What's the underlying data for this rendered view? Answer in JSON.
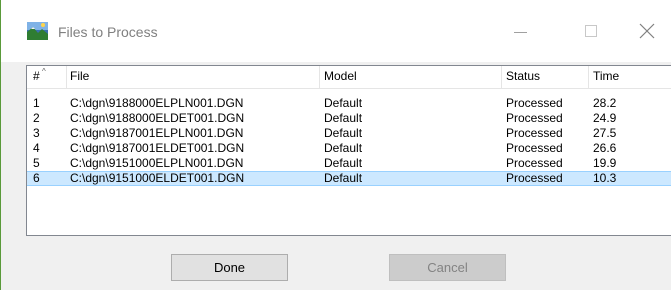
{
  "window": {
    "title": "Files to Process",
    "app_icon": "landscape-image-icon",
    "controls": [
      "minimize-icon",
      "maximize-icon",
      "close-icon"
    ]
  },
  "table": {
    "columns": [
      "#",
      "File",
      "Model",
      "Status",
      "Time"
    ],
    "sort_indicator": "^",
    "rows": [
      {
        "num": "1",
        "file": "C:\\dgn\\9188000ELPLN001.DGN",
        "model": "Default",
        "status": "Processed",
        "time": "28.2"
      },
      {
        "num": "2",
        "file": "C:\\dgn\\9188000ELDET001.DGN",
        "model": "Default",
        "status": "Processed",
        "time": "24.9"
      },
      {
        "num": "3",
        "file": "C:\\dgn\\9187001ELPLN001.DGN",
        "model": "Default",
        "status": "Processed",
        "time": "27.5"
      },
      {
        "num": "4",
        "file": "C:\\dgn\\9187001ELDET001.DGN",
        "model": "Default",
        "status": "Processed",
        "time": "26.6"
      },
      {
        "num": "5",
        "file": "C:\\dgn\\9151000ELPLN001.DGN",
        "model": "Default",
        "status": "Processed",
        "time": "19.9"
      },
      {
        "num": "6",
        "file": "C:\\dgn\\9151000ELDET001.DGN",
        "model": "Default",
        "status": "Processed",
        "time": "10.3"
      }
    ],
    "selected_row": 6
  },
  "buttons": {
    "done": "Done",
    "cancel": "Cancel"
  },
  "colors": {
    "selection": "#cce8ff",
    "selection_border": "#99d1ff",
    "dialog_background": "#f0f0f0",
    "disabled_text": "#838383"
  }
}
